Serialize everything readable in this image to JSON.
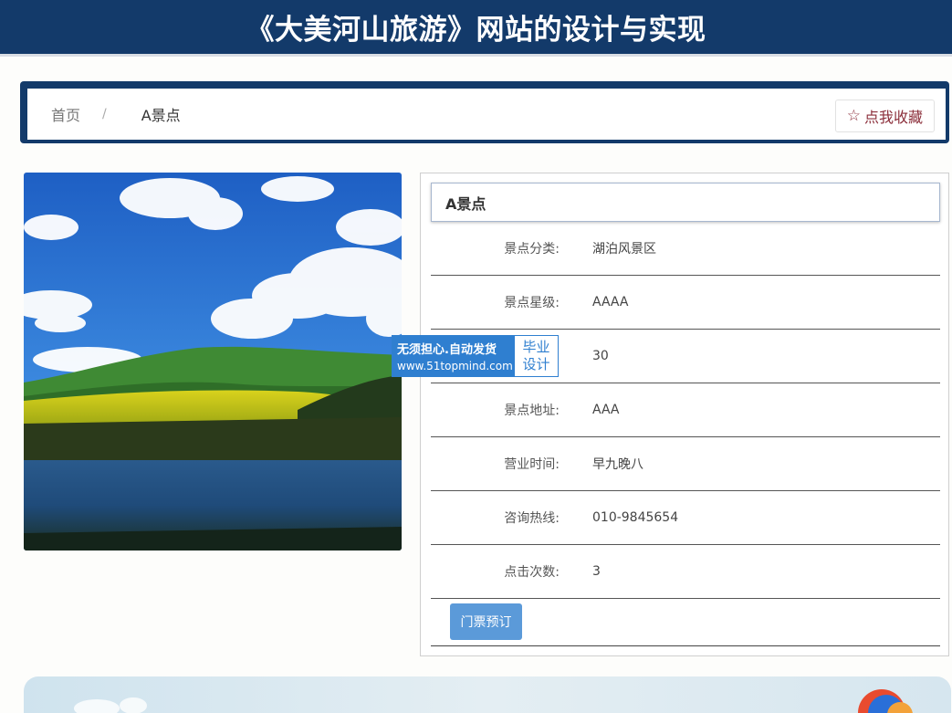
{
  "header": {
    "title": "《大美河山旅游》网站的设计与实现"
  },
  "breadcrumb": {
    "home": "首页",
    "separator": "/",
    "current": "A景点"
  },
  "favorite": {
    "label": "点我收藏",
    "icon": "star-outline-icon"
  },
  "watermark": {
    "line1": "无须担心.自动发货",
    "line2": "www.51topmind.com",
    "badge_line1": "毕业",
    "badge_line2": "设计"
  },
  "detail": {
    "title": "A景点",
    "rows": [
      {
        "label": "景点分类:",
        "value": "湖泊风景区"
      },
      {
        "label": "景点星级:",
        "value": "AAAA"
      },
      {
        "label": "",
        "value": "30"
      },
      {
        "label": "景点地址:",
        "value": "AAA"
      },
      {
        "label": "营业时间:",
        "value": "早九晚八"
      },
      {
        "label": "咨询热线:",
        "value": "010-9845654"
      },
      {
        "label": "点击次数:",
        "value": "3"
      }
    ],
    "book_button": "门票预订"
  },
  "colors": {
    "header_bg": "#133a6a",
    "favorite_text": "#8b2e3a",
    "book_button": "#5b9ad9",
    "watermark": "#2f7fd0"
  }
}
